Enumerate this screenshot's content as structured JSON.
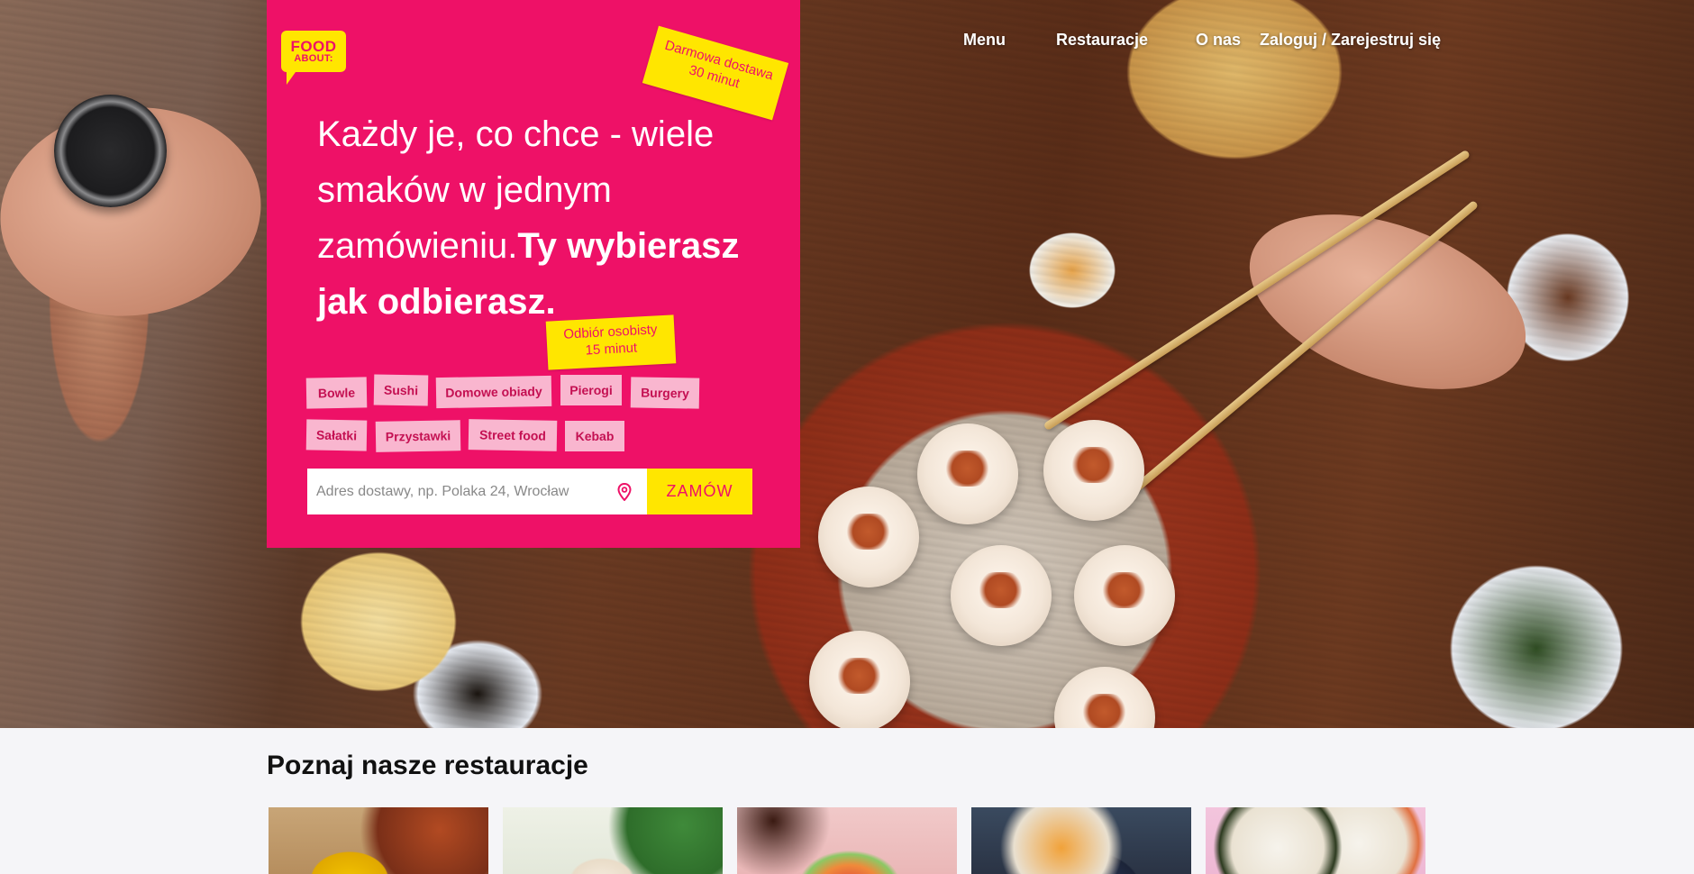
{
  "logo": {
    "line1": "FOOD",
    "line2": "ABOUT:"
  },
  "nav": {
    "menu": "Menu",
    "restaurants": "Restauracje",
    "about": "O nas",
    "login": "Zaloguj / Zarejestruj się"
  },
  "hero": {
    "headline_regular": "Każdy je, co chce - wiele smaków w jednym zamówieniu.",
    "headline_bold": "Ty wybierasz jak odbierasz.",
    "sticker_delivery_line1": "Darmowa dostawa",
    "sticker_delivery_line2": "30 minut",
    "sticker_pickup_line1": "Odbiór osobisty",
    "sticker_pickup_line2": "15 minut",
    "tags": [
      "Bowle",
      "Sushi",
      "Domowe obiady",
      "Pierogi",
      "Burgery",
      "Sałatki",
      "Przystawki",
      "Street food",
      "Kebab"
    ],
    "search_placeholder": "Adres dostawy, np. Polaka 24, Wrocław",
    "order_button": "ZAMÓW"
  },
  "restaurants": {
    "title": "Poznaj nasze restauracje"
  },
  "colors": {
    "brand_pink": "#ee1167",
    "brand_yellow": "#ffe600",
    "tag_background": "#f9b6cf"
  },
  "icons": {
    "search_field": "map-pin-icon"
  }
}
